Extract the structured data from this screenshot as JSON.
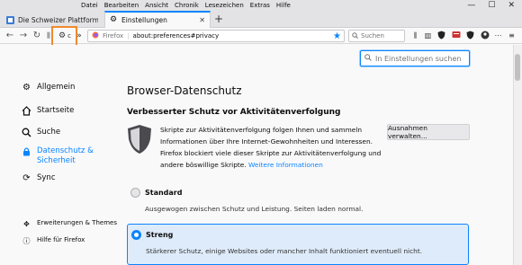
{
  "menu": [
    {
      "label": "Datei"
    },
    {
      "label": "Bearbeiten"
    },
    {
      "label": "Ansicht"
    },
    {
      "label": "Chronik"
    },
    {
      "label": "Lesezeichen"
    },
    {
      "label": "Extras"
    },
    {
      "label": "Hilfe"
    }
  ],
  "window_controls": {
    "minimize": "—",
    "maximize": "☐",
    "close": "✕"
  },
  "tabs": [
    {
      "title": "Die Schweizer Plattform für Co",
      "close": "✕"
    },
    {
      "title": "Einstellungen",
      "close": "✕"
    }
  ],
  "new_tab": "+",
  "nav": {
    "back": "←",
    "forward": "→",
    "reload": "↻",
    "ext_gear": "⚙",
    "ext_label": "c",
    "overflow": "»"
  },
  "urlbar": {
    "identity": "Firefox",
    "url": "about:preferences#privacy",
    "star": "★"
  },
  "searchbar": {
    "placeholder": "Suchen"
  },
  "toolbar_icons": [
    "library-icon",
    "sidebar-icon",
    "shield-icon",
    "extension-icon",
    "account-icon",
    "dots-icon",
    "menu-icon"
  ],
  "prefs_search": {
    "placeholder": "In Einstellungen suchen"
  },
  "sidebar": {
    "items": [
      {
        "label": "Allgemein",
        "icon": "gear-icon"
      },
      {
        "label": "Startseite",
        "icon": "home-icon"
      },
      {
        "label": "Suche",
        "icon": "search-icon"
      },
      {
        "label": "Datenschutz & Sicherheit",
        "icon": "lock-icon"
      },
      {
        "label": "Sync",
        "icon": "sync-icon"
      }
    ],
    "footer": [
      {
        "label": "Erweiterungen & Themes",
        "icon": "puzzle-icon"
      },
      {
        "label": "Hilfe für Firefox",
        "icon": "help-icon"
      }
    ]
  },
  "main": {
    "heading": "Browser-Datenschutz",
    "section_title": "Verbesserter Schutz vor Aktivitätenverfolgung",
    "description": "Skripte zur Aktivitätenverfolgung folgen Ihnen und sammeln Informationen über Ihre Internet-Gewohnheiten und Interessen. Firefox blockiert viele dieser Skripte zur Aktivitätenverfolgung und andere böswillige Skripte.",
    "more_link": "Weitere Informationen",
    "exceptions_button": "Ausnahmen verwalten...",
    "options": [
      {
        "title": "Standard",
        "desc": "Ausgewogen zwischen Schutz und Leistung. Seiten laden normal.",
        "selected": false
      },
      {
        "title": "Streng",
        "desc": "Stärkerer Schutz, einige Websites oder mancher Inhalt funktioniert eventuell nicht.",
        "selected": true
      }
    ]
  },
  "colors": {
    "accent": "#0a84ff",
    "highlight": "#f0892f",
    "selected_bg": "#deebfa"
  }
}
